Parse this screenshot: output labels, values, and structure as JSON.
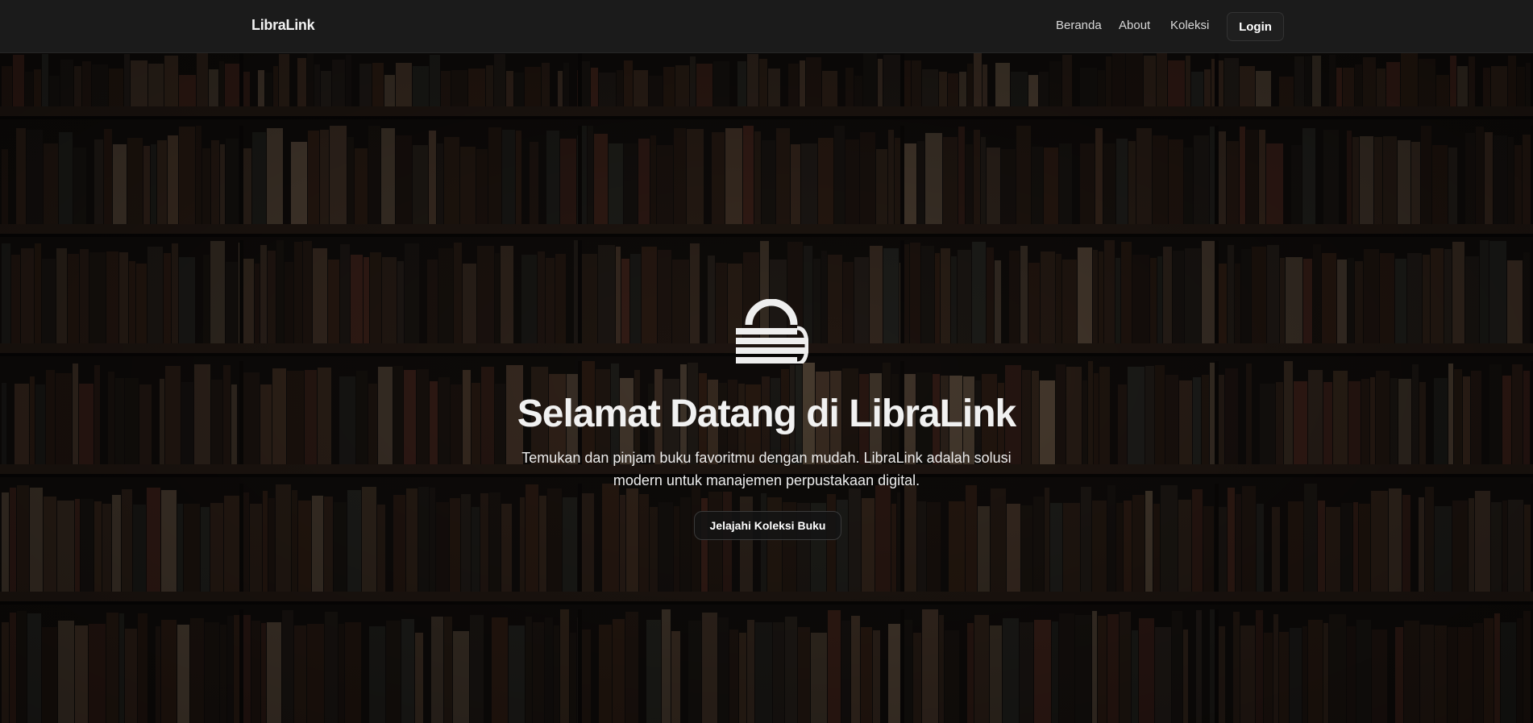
{
  "brand": {
    "name": "LibraLink"
  },
  "nav": {
    "links": [
      {
        "label": "Beranda"
      },
      {
        "label": "About"
      },
      {
        "label": "Koleksi"
      }
    ],
    "login_label": "Login"
  },
  "hero": {
    "icon": "library-logo-icon",
    "title": "Selamat Datang di LibraLink",
    "subtitle_line1": "Temukan dan pinjam buku favoritmu dengan mudah. LibraLink adalah solusi",
    "subtitle_line2": "modern untuk manajemen perpustakaan digital.",
    "cta_label": "Jelajahi Koleksi Buku",
    "background": "bookshelves-photo"
  },
  "colors": {
    "navbar_bg": "#1b1b1b",
    "text_primary": "#f1f1f1",
    "hero_overlay": "#000000"
  }
}
